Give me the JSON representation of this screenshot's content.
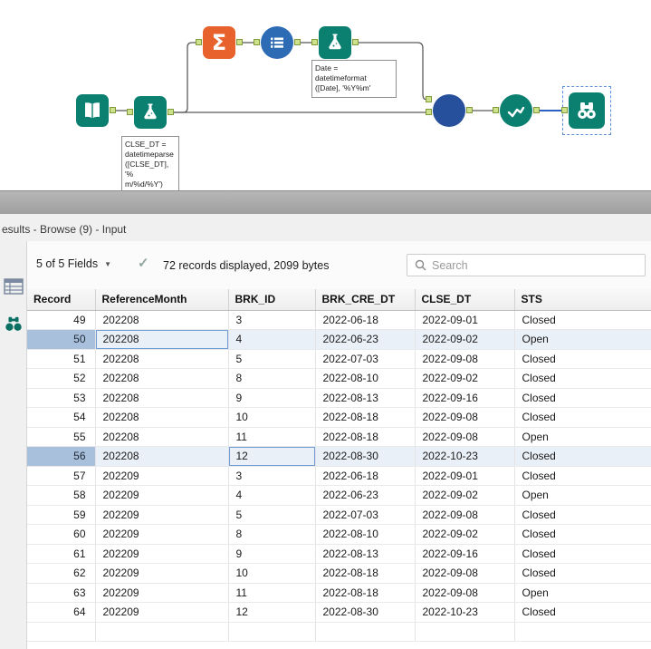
{
  "canvas": {
    "glyphs": {
      "sigma": "Σ"
    },
    "icons": {
      "input": "book-icon",
      "formula": "flask-icon",
      "summarize": "sigma-icon",
      "transform": "list-circle-icon",
      "join": "circle-icon",
      "check": "check-wave-icon",
      "browse": "binoculars-icon"
    },
    "annotations": {
      "formula1": "CLSE_DT =\ndatetimeparse\n([CLSE_DT], '%\nm/%d/%Y')",
      "formula2": "Date =\ndatetimeformat\n([Date], '%Y%m'"
    },
    "colors": {
      "tool_teal": "#0b8070",
      "tool_orange": "#e8622d",
      "tool_blue": "#2d6cb5",
      "tool_navy": "#26509b",
      "selected_wire": "#2f5fc0"
    }
  },
  "results": {
    "pane_title": "esults - Browse (9) - Input",
    "toolbar": {
      "fields_dropdown": "5 of 5 Fields",
      "apply_check": "✓",
      "records_info": "72 records displayed, 2099 bytes",
      "search_placeholder": "Search"
    },
    "table": {
      "columns": [
        "Record",
        "ReferenceMonth",
        "BRK_ID",
        "BRK_CRE_DT",
        "CLSE_DT",
        "STS"
      ],
      "rows": [
        [
          49,
          "202208",
          "3",
          "2022-06-18",
          "2022-09-01",
          "Closed"
        ],
        [
          50,
          "202208",
          "4",
          "2022-06-23",
          "2022-09-02",
          "Open"
        ],
        [
          51,
          "202208",
          "5",
          "2022-07-03",
          "2022-09-08",
          "Closed"
        ],
        [
          52,
          "202208",
          "8",
          "2022-08-10",
          "2022-09-02",
          "Closed"
        ],
        [
          53,
          "202208",
          "9",
          "2022-08-13",
          "2022-09-16",
          "Closed"
        ],
        [
          54,
          "202208",
          "10",
          "2022-08-18",
          "2022-09-08",
          "Closed"
        ],
        [
          55,
          "202208",
          "11",
          "2022-08-18",
          "2022-09-08",
          "Open"
        ],
        [
          56,
          "202208",
          "12",
          "2022-08-30",
          "2022-10-23",
          "Closed"
        ],
        [
          57,
          "202209",
          "3",
          "2022-06-18",
          "2022-09-01",
          "Closed"
        ],
        [
          58,
          "202209",
          "4",
          "2022-06-23",
          "2022-09-02",
          "Open"
        ],
        [
          59,
          "202209",
          "5",
          "2022-07-03",
          "2022-09-08",
          "Closed"
        ],
        [
          60,
          "202209",
          "8",
          "2022-08-10",
          "2022-09-02",
          "Closed"
        ],
        [
          61,
          "202209",
          "9",
          "2022-08-13",
          "2022-09-16",
          "Closed"
        ],
        [
          62,
          "202209",
          "10",
          "2022-08-18",
          "2022-09-08",
          "Closed"
        ],
        [
          63,
          "202209",
          "11",
          "2022-08-18",
          "2022-09-08",
          "Open"
        ],
        [
          64,
          "202209",
          "12",
          "2022-08-30",
          "2022-10-23",
          "Closed"
        ]
      ],
      "highlighted_records": [
        50,
        56
      ],
      "outlined_cells": [
        {
          "record": 50,
          "column": "ReferenceMonth"
        },
        {
          "record": 56,
          "column": "BRK_ID"
        }
      ]
    }
  }
}
